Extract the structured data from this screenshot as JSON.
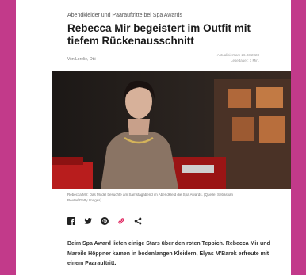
{
  "article": {
    "kicker": "Abendkleider und Paarauftritte bei Spa Awards",
    "headline": "Rebecca Mir begeistert im Outfit mit tiefem Rückenausschnitt",
    "byline": "Von Lorelie, Otti",
    "updated": "Aktualisiert am 26.03.2023",
    "read_time": "Lesedauer: 1 Min.",
    "caption": "Rebecca Mir: Das Model besuchte am Samstagabend im Abendkleid die Spa Awards. (Quelle: Sebastian Reuter/Getty Images)",
    "lead": "Beim Spa Award liefen einige Stars über den roten Teppich. Rebecca Mir und Mareile Höppner kamen in bodenlangen Kleidern, Elyas M'Barek erfreute mit einem Paarauftritt."
  },
  "share_icons": [
    "facebook-icon",
    "twitter-icon",
    "pinterest-icon",
    "link-icon",
    "share-icon"
  ],
  "colors": {
    "page_background": "#c23a8a",
    "link_icon": "#e0245e"
  }
}
